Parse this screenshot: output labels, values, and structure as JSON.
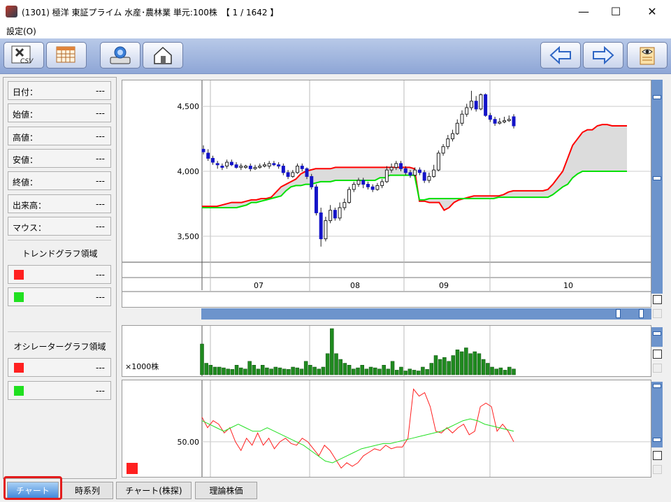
{
  "window": {
    "title": "(1301) 極洋 東証プライム 水産･農林業 単元:100株　【 1 / 1642 】",
    "minimize": "—",
    "maximize": "☐",
    "close": "✕"
  },
  "menu": {
    "settings": "設定(O)"
  },
  "toolbar": {
    "buttons": [
      {
        "name": "csv-export-button",
        "icon": "csv-icon",
        "label": "CSV"
      },
      {
        "name": "calendar-button",
        "icon": "calendar-icon"
      },
      {
        "name": "scan-button",
        "icon": "scanner-icon"
      },
      {
        "name": "home-button",
        "icon": "home-icon"
      },
      {
        "name": "prev-button",
        "icon": "arrow-left-icon"
      },
      {
        "name": "next-button",
        "icon": "arrow-right-icon"
      },
      {
        "name": "view-button",
        "icon": "eye-icon"
      }
    ]
  },
  "info": {
    "rows": [
      {
        "label": "日付：",
        "value": "---"
      },
      {
        "label": "始値：",
        "value": "---"
      },
      {
        "label": "高値：",
        "value": "---"
      },
      {
        "label": "安値：",
        "value": "---"
      },
      {
        "label": "終値：",
        "value": "---"
      },
      {
        "label": "出来高：",
        "value": "---"
      },
      {
        "label": "マウス：",
        "value": "---"
      }
    ],
    "trend_title": "トレンドグラフ領域",
    "trend_rows": [
      {
        "color": "#ff2020",
        "value": "---"
      },
      {
        "color": "#20e020",
        "value": "---"
      }
    ],
    "osc_title": "オシレーターグラフ領域",
    "osc_rows": [
      {
        "color": "#ff2020",
        "value": "---"
      },
      {
        "color": "#20e020",
        "value": "---"
      }
    ]
  },
  "tabs": [
    {
      "label": "チャート",
      "active": true
    },
    {
      "label": "時系列",
      "active": false
    },
    {
      "label": "チャート(株探)",
      "active": false
    },
    {
      "label": "理論株価",
      "active": false
    }
  ],
  "chart_data": [
    {
      "type": "candlestick",
      "title": "",
      "ylim": [
        3300,
        4700
      ],
      "yticks": [
        {
          "v": 3500,
          "label": "3,500"
        },
        {
          "v": 4000,
          "label": "4,000"
        },
        {
          "v": 4500,
          "label": "4,500"
        }
      ],
      "months": [
        "07",
        "08",
        "09",
        "10"
      ],
      "candles": [
        [
          4170,
          4150,
          4200,
          4130
        ],
        [
          4140,
          4100,
          4170,
          4080
        ],
        [
          4100,
          4070,
          4120,
          4050
        ],
        [
          4060,
          4050,
          4080,
          4020
        ],
        [
          4040,
          4030,
          4060,
          4010
        ],
        [
          4040,
          4070,
          4090,
          4020
        ],
        [
          4070,
          4050,
          4090,
          4040
        ],
        [
          4050,
          4030,
          4070,
          4020
        ],
        [
          4030,
          4040,
          4060,
          4010
        ],
        [
          4030,
          4040,
          4050,
          4020
        ],
        [
          4040,
          4020,
          4060,
          4000
        ],
        [
          4020,
          4030,
          4050,
          4010
        ],
        [
          4030,
          4040,
          4060,
          4020
        ],
        [
          4040,
          4050,
          4070,
          4030
        ],
        [
          4040,
          4060,
          4080,
          4020
        ],
        [
          4060,
          4050,
          4080,
          4040
        ],
        [
          4050,
          4040,
          4070,
          4020
        ],
        [
          4040,
          3990,
          4060,
          3970
        ],
        [
          3990,
          3960,
          4010,
          3940
        ],
        [
          3960,
          3990,
          4010,
          3950
        ],
        [
          3990,
          4040,
          4060,
          3980
        ],
        [
          4040,
          4020,
          4060,
          4000
        ],
        [
          4020,
          3960,
          4030,
          3940
        ],
        [
          3960,
          3880,
          3980,
          3860
        ],
        [
          3880,
          3680,
          3900,
          3660
        ],
        [
          3680,
          3480,
          3720,
          3420
        ],
        [
          3480,
          3620,
          3650,
          3460
        ],
        [
          3620,
          3700,
          3740,
          3600
        ],
        [
          3700,
          3640,
          3720,
          3620
        ],
        [
          3640,
          3720,
          3760,
          3620
        ],
        [
          3720,
          3760,
          3790,
          3700
        ],
        [
          3760,
          3860,
          3880,
          3750
        ],
        [
          3860,
          3900,
          3920,
          3840
        ],
        [
          3900,
          3930,
          3950,
          3880
        ],
        [
          3930,
          3900,
          3950,
          3870
        ],
        [
          3900,
          3880,
          3920,
          3860
        ],
        [
          3880,
          3860,
          3900,
          3840
        ],
        [
          3860,
          3890,
          3910,
          3850
        ],
        [
          3890,
          3920,
          3940,
          3870
        ],
        [
          3920,
          4010,
          4040,
          3910
        ],
        [
          4010,
          4030,
          4060,
          3990
        ],
        [
          4030,
          4060,
          4080,
          4010
        ],
        [
          4060,
          4020,
          4080,
          4000
        ],
        [
          4020,
          3990,
          4040,
          3970
        ],
        [
          3990,
          3970,
          4010,
          3950
        ],
        [
          3970,
          4010,
          4030,
          3960
        ],
        [
          4010,
          3990,
          4030,
          3970
        ],
        [
          3990,
          3930,
          4010,
          3910
        ],
        [
          3930,
          3960,
          3990,
          3910
        ],
        [
          3960,
          4010,
          4050,
          3950
        ],
        [
          4010,
          4140,
          4160,
          4000
        ],
        [
          4140,
          4190,
          4210,
          4120
        ],
        [
          4190,
          4250,
          4280,
          4170
        ],
        [
          4250,
          4290,
          4320,
          4230
        ],
        [
          4290,
          4370,
          4400,
          4280
        ],
        [
          4370,
          4440,
          4470,
          4350
        ],
        [
          4440,
          4490,
          4520,
          4420
        ],
        [
          4490,
          4540,
          4620,
          4470
        ],
        [
          4540,
          4480,
          4580,
          4460
        ],
        [
          4480,
          4590,
          4600,
          4470
        ],
        [
          4590,
          4430,
          4600,
          4420
        ],
        [
          4430,
          4400,
          4450,
          4380
        ],
        [
          4400,
          4370,
          4420,
          4350
        ],
        [
          4370,
          4380,
          4410,
          4360
        ],
        [
          4380,
          4390,
          4420,
          4370
        ],
        [
          4390,
          4400,
          4430,
          4380
        ],
        [
          4420,
          4350,
          4440,
          4330
        ]
      ],
      "series": [
        {
          "color": "#ff0000",
          "values": [
            3730,
            3730,
            3730,
            3730,
            3740,
            3750,
            3760,
            3760,
            3760,
            3770,
            3780,
            3780,
            3790,
            3790,
            3800,
            3840,
            3880,
            3900,
            3920,
            3940,
            3980,
            4000,
            4010,
            4020,
            4020,
            4020,
            4020,
            4030,
            4030,
            4030,
            4030,
            4030,
            4030,
            4030,
            4030,
            4030,
            4030,
            4030,
            4030,
            4030,
            4030,
            4030,
            4030,
            4020,
            3770,
            3770,
            3760,
            3760,
            3760,
            3700,
            3720,
            3760,
            3780,
            3790,
            3800,
            3810,
            3810,
            3810,
            3810,
            3810,
            3810,
            3820,
            3840,
            3850,
            3850,
            3850,
            3850,
            3850,
            3850,
            3850,
            3860,
            3900,
            3950,
            4000,
            4100,
            4200,
            4250,
            4300,
            4320,
            4320,
            4350,
            4360,
            4360,
            4350,
            4350,
            4350,
            4350
          ]
        },
        {
          "color": "#00e000",
          "values": [
            3720,
            3720,
            3720,
            3720,
            3720,
            3720,
            3720,
            3720,
            3730,
            3740,
            3760,
            3760,
            3770,
            3780,
            3790,
            3800,
            3810,
            3850,
            3880,
            3890,
            3890,
            3900,
            3900,
            3910,
            3920,
            3920,
            3920,
            3930,
            3930,
            3930,
            3930,
            3930,
            3930,
            3930,
            3930,
            3930,
            3950,
            3950,
            3970,
            3970,
            3970,
            3970,
            3970,
            3970,
            3780,
            3780,
            3790,
            3790,
            3790,
            3790,
            3790,
            3790,
            3790,
            3790,
            3790,
            3790,
            3790,
            3790,
            3790,
            3790,
            3800,
            3800,
            3800,
            3800,
            3800,
            3800,
            3800,
            3800,
            3800,
            3800,
            3800,
            3820,
            3850,
            3880,
            3900,
            3950,
            3980,
            4000,
            4000,
            4000,
            4000,
            4000,
            4000,
            4000,
            4000,
            4000,
            4000
          ]
        }
      ]
    },
    {
      "type": "bar",
      "title": "",
      "ylabel": "×1000株",
      "values": [
        80,
        30,
        25,
        20,
        20,
        18,
        15,
        14,
        25,
        18,
        15,
        35,
        25,
        15,
        25,
        18,
        15,
        20,
        18,
        15,
        14,
        20,
        18,
        15,
        35,
        25,
        20,
        15,
        20,
        55,
        120,
        55,
        40,
        30,
        25,
        15,
        18,
        25,
        15,
        20,
        18,
        15,
        25,
        15,
        35,
        12,
        20,
        10,
        15,
        12,
        10,
        20,
        14,
        30,
        50,
        40,
        45,
        35,
        50,
        65,
        60,
        70,
        55,
        60,
        55,
        40,
        30,
        20,
        15,
        18,
        12,
        20,
        15
      ]
    },
    {
      "type": "line",
      "title": "",
      "ylim": [
        30,
        85
      ],
      "yticks": [
        {
          "v": 50,
          "label": "50.00"
        }
      ],
      "series": [
        {
          "color": "#ff2020",
          "values": [
            64,
            58,
            62,
            60,
            55,
            58,
            50,
            45,
            52,
            48,
            55,
            48,
            52,
            46,
            50,
            52,
            49,
            48,
            52,
            50,
            46,
            42,
            48,
            45,
            40,
            35,
            38,
            36,
            38,
            42,
            44,
            46,
            45,
            48,
            46,
            47,
            47,
            52,
            80,
            76,
            78,
            70,
            56,
            55,
            58,
            55,
            58,
            60,
            54,
            56,
            70,
            72,
            70,
            56,
            60,
            56,
            50
          ]
        },
        {
          "color": "#22e022",
          "values": [
            62,
            60,
            58,
            56,
            58,
            60,
            58,
            56,
            56,
            58,
            56,
            54,
            52,
            50,
            48,
            45,
            42,
            39,
            38,
            40,
            42,
            44,
            46,
            47,
            48,
            49,
            49,
            50,
            51,
            52,
            53,
            54,
            55,
            56,
            58,
            60,
            62,
            63,
            62,
            60,
            59,
            58,
            57,
            56
          ]
        }
      ]
    }
  ]
}
